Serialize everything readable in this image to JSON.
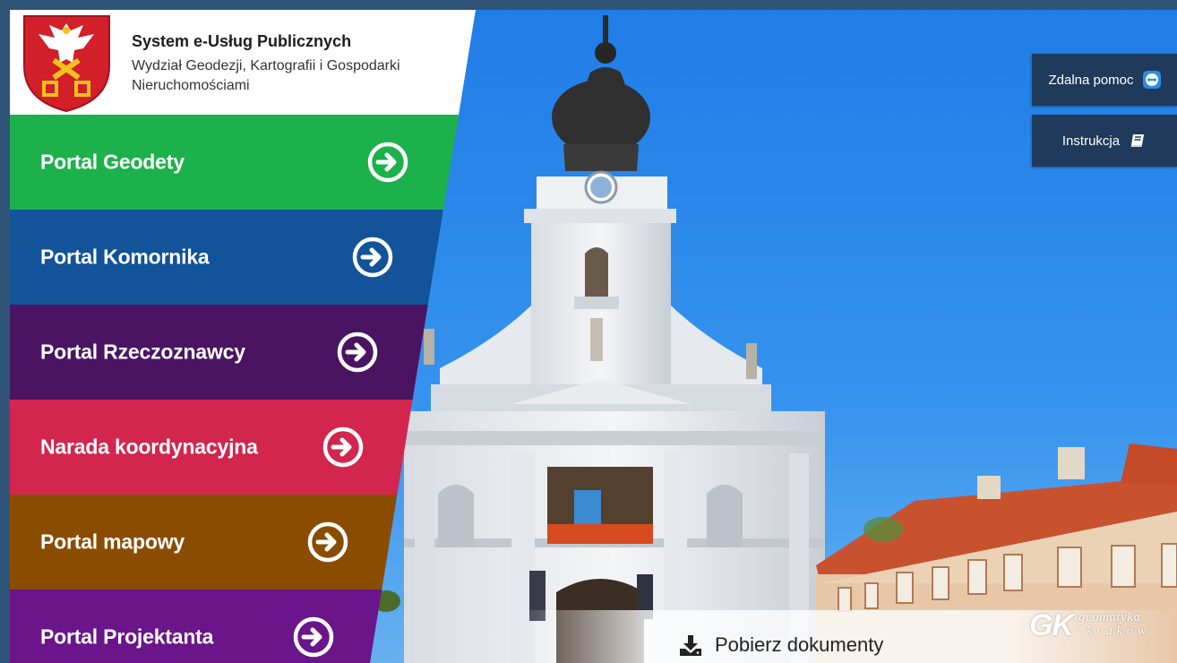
{
  "header": {
    "title": "System e-Usług Publicznych",
    "subtitle_line1": "Wydział Geodezji, Kartografii i Gospodarki",
    "subtitle_line2": "Nieruchomościami"
  },
  "menu": {
    "items": [
      {
        "label": "Portal Geodety",
        "color": "#1db14b"
      },
      {
        "label": "Portal Komornika",
        "color": "#12539a"
      },
      {
        "label": "Portal Rzeczoznawcy",
        "color": "#4a1463"
      },
      {
        "label": "Narada koordynacyjna",
        "color": "#d2264f"
      },
      {
        "label": "Portal mapowy",
        "color": "#8a4d00"
      },
      {
        "label": "Portal Projektanta",
        "color": "#6a158a"
      }
    ]
  },
  "side_buttons": {
    "remote_help": {
      "label": "Zdalna pomoc",
      "icon": "teamviewer-icon"
    },
    "manual": {
      "label": "Instrukcja",
      "icon": "book-icon"
    }
  },
  "bottom": {
    "download_label": "Pobierz dokumenty",
    "download_icon": "download-icon"
  },
  "logo": {
    "mark": "GK",
    "line1": "geomatyka",
    "line2": "kraków"
  },
  "colors": {
    "frame": "#2f5478",
    "button_bg": "#1f3a5a",
    "sky": "#2a86e6"
  }
}
